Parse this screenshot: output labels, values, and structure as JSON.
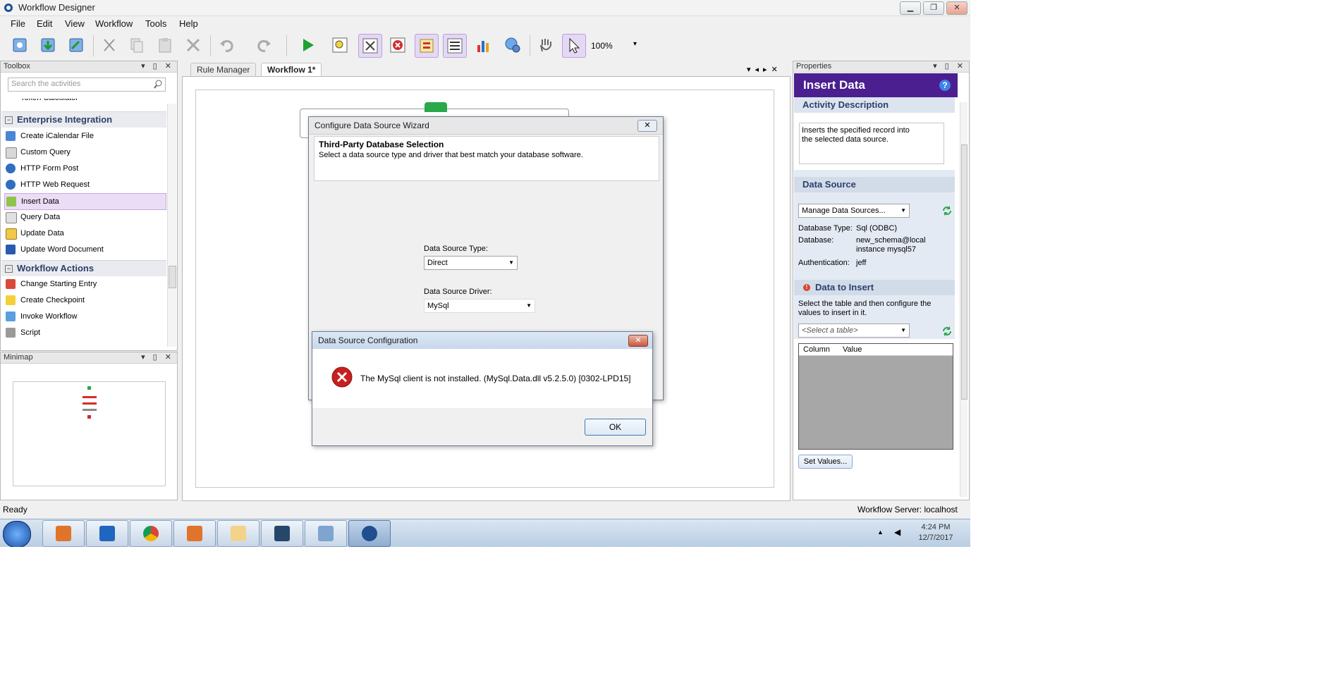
{
  "window": {
    "title": "Workflow Designer",
    "controls": [
      "▁",
      "❐",
      "✕"
    ]
  },
  "menu": [
    "File",
    "Edit",
    "View",
    "Workflow",
    "Tools",
    "Help"
  ],
  "toolbar": {
    "zoom": "100%",
    "zoom_arrow": "▾"
  },
  "toolbox": {
    "title": "Toolbox",
    "search_placeholder": "Search the activities",
    "partial_item": "Token Calculator",
    "groups": [
      {
        "label": "Enterprise Integration",
        "items": [
          "Create iCalendar File",
          "Custom Query",
          "HTTP Form Post",
          "HTTP Web Request",
          "Insert Data",
          "Query Data",
          "Update Data",
          "Update Word Document"
        ]
      },
      {
        "label": "Workflow Actions",
        "items": [
          "Change Starting Entry",
          "Create Checkpoint",
          "Invoke Workflow",
          "Script"
        ]
      }
    ],
    "selected": "Insert Data"
  },
  "minimap": {
    "title": "Minimap"
  },
  "tabs": [
    "Rule Manager",
    "Workflow 1*"
  ],
  "wizard": {
    "title": "Configure Data Source Wizard",
    "heading": "Third-Party Database Selection",
    "subheading": "Select a data source type and driver that best match your database software.",
    "type_label": "Data Source Type:",
    "type_value": "Direct",
    "driver_label": "Data Source Driver:",
    "driver_value": "MySql"
  },
  "error_dialog": {
    "title": "Data Source Configuration",
    "message": "The MySql client is not installed. (MySql.Data.dll v5.2.5.0) [0302-LPD15]",
    "ok": "OK"
  },
  "properties": {
    "title": "Properties",
    "header": "Insert Data",
    "help": "?",
    "activity_description_label": "Activity Description",
    "activity_description": "Inserts the specified record into the selected data source.",
    "data_source_label": "Data Source",
    "data_source_value": "Manage Data Sources...",
    "db_type_label": "Database Type:",
    "db_type_value": "Sql (ODBC)",
    "database_label": "Database:",
    "database_value_1": "new_schema@local",
    "database_value_2": "instance mysql57",
    "auth_label": "Authentication:",
    "auth_value": "jeff",
    "data_to_insert_label": "Data to Insert",
    "data_to_insert_desc": "Select the table and then configure the values to insert in it.",
    "table_placeholder": "<Select a table>",
    "col_header": "Column",
    "val_header": "Value",
    "set_values": "Set Values..."
  },
  "status": {
    "left": "Ready",
    "right": "Workflow Server: localhost"
  },
  "taskbar": {
    "time": "4:24 PM",
    "date": "12/7/2017"
  }
}
